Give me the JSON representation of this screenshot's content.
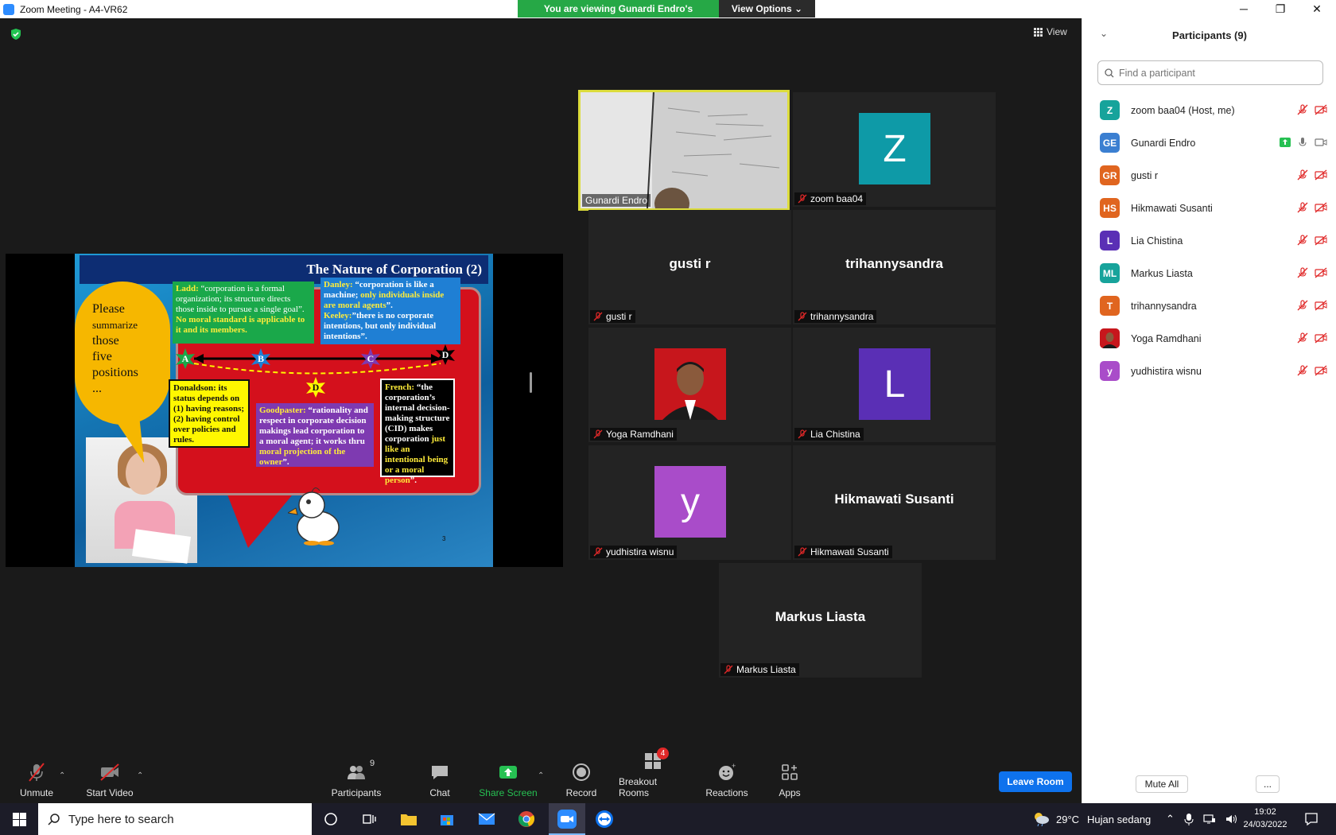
{
  "window": {
    "title": "Zoom Meeting - A4-VR62",
    "banner": "You are viewing Gunardi Endro's screen",
    "view_options": "View Options"
  },
  "meeting": {
    "view_label": "View"
  },
  "slide": {
    "title": "The Nature of Corporation (2)",
    "bubble_lines": [
      "Please",
      "summarize",
      "those",
      "five",
      "positions",
      "..."
    ],
    "ladd_label": "Ladd:",
    "ladd_text": " “corporation is a formal organization; its structure directs those inside to pursue a single goal”. ",
    "ladd_highlight": "No moral standard is applicable to it and its members.",
    "danley_label": "Danley:",
    "danley_text": " “corporation is like a machine; ",
    "danley_highlight": "only individuals inside are moral agents",
    "danley_end": "”.",
    "keeley_label": "Keeley:",
    "keeley_text": "”there is no corporate intentions, but only individual intentions”.",
    "donaldson_text": "Donaldson:  its status depends on (1) having reasons; (2) having control over policies and rules.",
    "goodpaster_label": "Goodpaster:",
    "goodpaster_text": " “rationality and respect in corporate decision makings lead corporation to a moral agent; it works thru ",
    "goodpaster_highlight": "moral projection of the owner",
    "goodpaster_end": "”.",
    "french_label": "French:",
    "french_text": " “the corporation’s internal decision-making structure (CID) makes corporation ",
    "french_highlight": "just like an intentional being or a moral person",
    "french_end": "”.",
    "stars": [
      "A",
      "B",
      "C",
      "D",
      "D"
    ],
    "page_number": "3"
  },
  "tiles": [
    {
      "name": "Gunardi Endro",
      "type": "video"
    },
    {
      "name": "zoom baa04",
      "type": "avatar",
      "letter": "Z",
      "color": "#0e9aa7"
    },
    {
      "name": "gusti r",
      "type": "text"
    },
    {
      "name": "trihannysandra",
      "type": "text"
    },
    {
      "name": "Yoga Ramdhani",
      "type": "photo"
    },
    {
      "name": "Lia Chistina",
      "type": "avatar",
      "letter": "L",
      "color": "#5a2fb5"
    },
    {
      "name": "yudhistira wisnu",
      "type": "avatar",
      "letter": "y",
      "color": "#a94cc9"
    },
    {
      "name": "Hikmawati Susanti",
      "type": "text"
    },
    {
      "name": "Markus Liasta",
      "type": "text"
    }
  ],
  "toolbar": {
    "unmute": "Unmute",
    "start_video": "Start Video",
    "participants": "Participants",
    "participants_count": "9",
    "chat": "Chat",
    "share_screen": "Share Screen",
    "record": "Record",
    "breakout": "Breakout Rooms",
    "breakout_badge": "4",
    "reactions": "Reactions",
    "apps": "Apps",
    "leave": "Leave Room"
  },
  "panel": {
    "title": "Participants (9)",
    "search_placeholder": "Find a participant",
    "participants": [
      {
        "initials": "Z",
        "name": "zoom baa04 (Host, me)",
        "color": "#17a39b"
      },
      {
        "initials": "GE",
        "name": "Gunardi Endro",
        "color": "#3b7fd1",
        "sharing": true
      },
      {
        "initials": "GR",
        "name": "gusti r",
        "color": "#e0651f"
      },
      {
        "initials": "HS",
        "name": "Hikmawati Susanti",
        "color": "#e0651f"
      },
      {
        "initials": "L",
        "name": "Lia Chistina",
        "color": "#5a2fb5"
      },
      {
        "initials": "ML",
        "name": "Markus Liasta",
        "color": "#17a39b"
      },
      {
        "initials": "T",
        "name": "trihannysandra",
        "color": "#e0651f"
      },
      {
        "initials": "",
        "name": "Yoga Ramdhani",
        "color": "#c0282e",
        "photo": true
      },
      {
        "initials": "y",
        "name": "yudhistira wisnu",
        "color": "#a94cc9"
      }
    ],
    "mute_all": "Mute All",
    "more": "..."
  },
  "taskbar": {
    "search_placeholder": "Type here to search",
    "temperature": "29°C",
    "weather": "Hujan sedang",
    "time": "19:02",
    "date": "24/03/2022"
  }
}
